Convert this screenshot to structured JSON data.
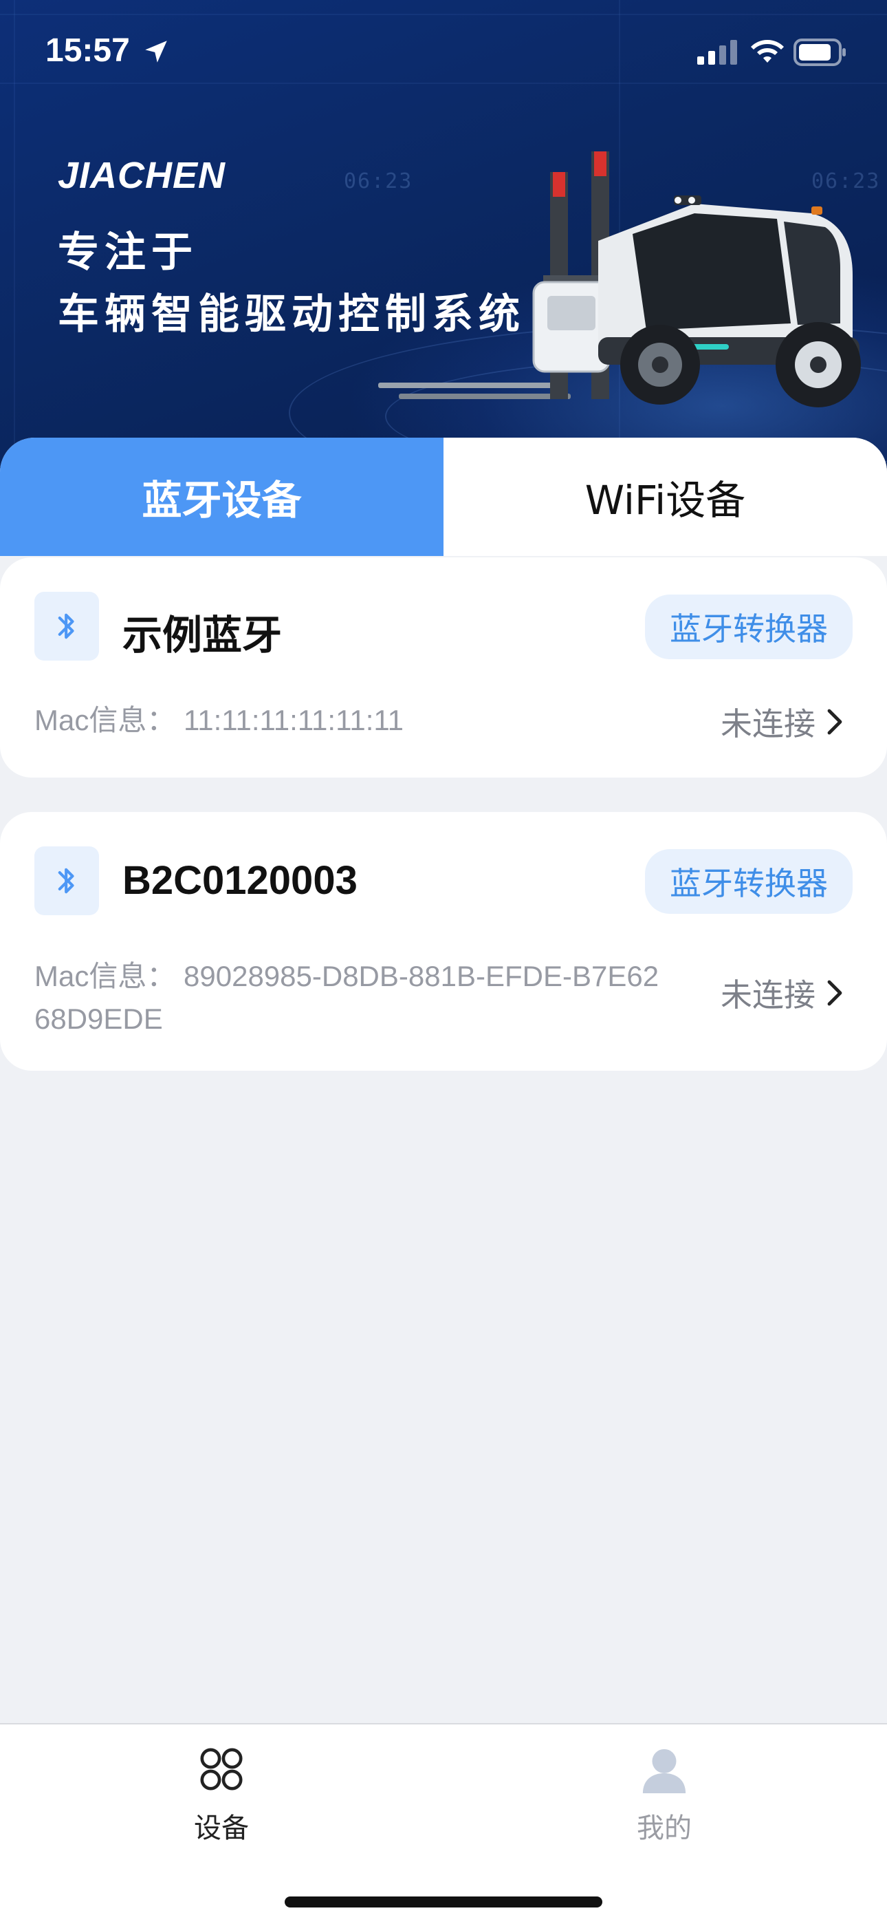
{
  "status_bar": {
    "time": "15:57",
    "icons": [
      "location-arrow-icon",
      "cellular-signal-icon",
      "wifi-icon",
      "battery-icon"
    ]
  },
  "banner": {
    "logo": "JIACHEN",
    "slogan_line1": "专注于",
    "slogan_line2": "车辆智能驱动控制系统"
  },
  "tabs": [
    {
      "label": "蓝牙设备",
      "active": true
    },
    {
      "label": "WiFi设备",
      "active": false
    }
  ],
  "devices": [
    {
      "name": "示例蓝牙",
      "type": "蓝牙转换器",
      "mac": "Mac信息：  11:11:11:11:11:11",
      "status": "未连接"
    },
    {
      "name": "B2C0120003",
      "type": "蓝牙转换器",
      "mac": "Mac信息：  89028985-D8DB-881B-EFDE-B7E6268D9EDE",
      "status": "未连接"
    }
  ],
  "bottom_nav": [
    {
      "label": "设备",
      "icon": "devices-grid-icon",
      "active": true
    },
    {
      "label": "我的",
      "icon": "user-profile-icon",
      "active": false
    }
  ],
  "colors": {
    "accent": "#4d97f5",
    "chip_bg": "#e8f1fd",
    "chip_text": "#3f8ee8",
    "banner_bg": "#0b2863",
    "page_bg": "#eff1f5"
  }
}
